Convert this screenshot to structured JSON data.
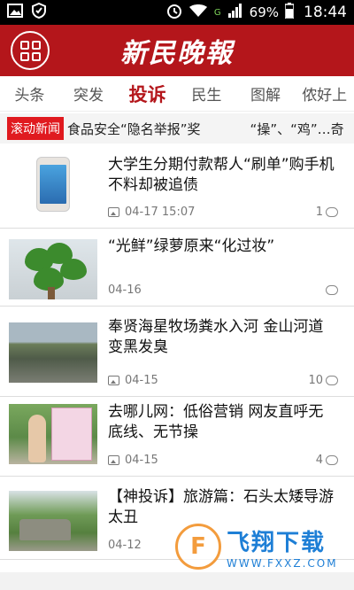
{
  "status_bar": {
    "battery_percent": "69%",
    "time": "18:44",
    "network": "G",
    "icons": [
      "image-icon",
      "shield-icon",
      "alarm-icon",
      "wifi-icon",
      "signal-icon",
      "battery-icon"
    ]
  },
  "header": {
    "logo_text": "新民晚報",
    "menu_icon": "grid-menu-icon",
    "brand_color": "#b4161b"
  },
  "tabs": [
    {
      "label": "头条",
      "active": false
    },
    {
      "label": "突发",
      "active": false
    },
    {
      "label": "投诉",
      "active": true
    },
    {
      "label": "民生",
      "active": false
    },
    {
      "label": "图解",
      "active": false
    },
    {
      "label": "侬好上",
      "active": false
    }
  ],
  "ticker": {
    "label": "滚动新闻",
    "items": [
      "食品安全“隐名举报”奖",
      "“操”、“鸡”…奇"
    ]
  },
  "news": [
    {
      "title": "大学生分期付款帮人“刷单”购手机 不料却被追债",
      "date": "04-17 15:07",
      "has_pic_icon": true,
      "comments": "1"
    },
    {
      "title": "“光鲜”绿萝原来“化过妆”",
      "date": "04-16",
      "has_pic_icon": false,
      "comments": ""
    },
    {
      "title": "奉贤海星牧场粪水入河 金山河道变黑发臭",
      "date": "04-15",
      "has_pic_icon": true,
      "comments": "10"
    },
    {
      "title": "去哪儿网：低俗营销 网友直呼无底线、无节操",
      "date": "04-15",
      "has_pic_icon": true,
      "comments": "4"
    },
    {
      "title": "【神投诉】旅游篇：石头太矮导游太丑",
      "date": "04-12",
      "has_pic_icon": false,
      "comments": ""
    }
  ],
  "watermark": {
    "title": "飞翔下载",
    "url": "WWW.FXXZ.COM",
    "color": "#1e7fd6"
  }
}
